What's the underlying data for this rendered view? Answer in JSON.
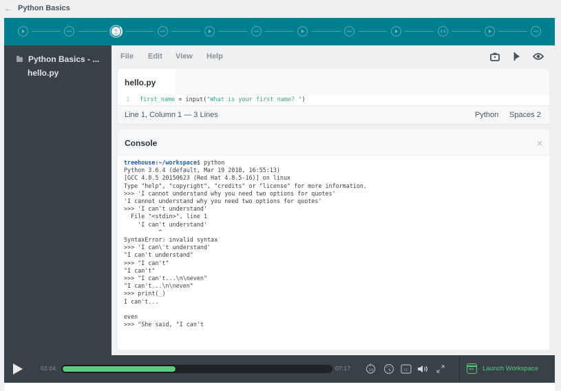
{
  "breadcrumb": {
    "back_icon": "arrow-left-icon",
    "title": "Python Basics"
  },
  "steps": [
    {
      "type": "video",
      "icon": "play-circle-icon",
      "current": false
    },
    {
      "type": "quiz",
      "icon": "ellipsis-circle-icon",
      "current": false
    },
    {
      "type": "current",
      "icon": "person-icon",
      "current": true
    },
    {
      "type": "quiz",
      "icon": "ellipsis-circle-icon",
      "current": false
    },
    {
      "type": "video",
      "icon": "play-circle-icon",
      "current": false
    },
    {
      "type": "quiz",
      "icon": "ellipsis-circle-icon",
      "current": false
    },
    {
      "type": "video",
      "icon": "play-circle-icon",
      "current": false
    },
    {
      "type": "quiz",
      "icon": "ellipsis-circle-icon",
      "current": false
    },
    {
      "type": "video",
      "icon": "play-circle-icon",
      "current": false
    },
    {
      "type": "code",
      "icon": "code-circle-icon",
      "current": false
    },
    {
      "type": "video",
      "icon": "play-circle-icon",
      "current": false
    },
    {
      "type": "quiz",
      "icon": "ellipsis-circle-icon",
      "current": false
    }
  ],
  "sidebar": {
    "folder": "Python Basics - ...",
    "files": [
      "hello.py"
    ]
  },
  "menubar": {
    "items": [
      "File",
      "Edit",
      "View",
      "Help"
    ],
    "icons": [
      "share-snapshot-icon",
      "fork-icon",
      "preview-eye-icon"
    ]
  },
  "editor": {
    "tab": "hello.py",
    "line_number": "1",
    "code": {
      "var": "first_name",
      "op": " = input(",
      "str": "\"What is your first name?  \"",
      "end": ")"
    },
    "status": {
      "position": "Line 1, Column 1 — 3 Lines",
      "language": "Python",
      "indent": "Spaces 2"
    }
  },
  "console": {
    "title": "Console",
    "close_icon": "close-icon",
    "prompt_user": "treehouse",
    "prompt_path": ":~/workspace",
    "prompt_symbol": "$ python",
    "lines": [
      "Python 3.6.4 (default, Mar 19 2018, 16:55:13)",
      "[GCC 4.8.5 20150623 (Red Hat 4.8.5-16)] on linux",
      "Type \"help\", \"copyright\", \"credits\" or \"license\" for more information.",
      ">>> 'I cannot understand why you need two options for quotes'",
      "'I cannot understand why you need two options for quotes'",
      ">>> 'I can't understand'",
      "  File \"<stdin>\", line 1",
      "    'I can't understand'",
      "          ^",
      "SyntaxError: invalid syntax",
      ">>> 'I can\\'t understand'",
      "\"I can't understand\"",
      ">>> \"I can't\"",
      "\"I can't\"",
      ">>> \"I can't...\\n\\neven\"",
      "\"I can't...\\n\\neven\"",
      ">>> print(_)",
      "I can't...",
      "",
      "even",
      ">>> \"She said, \"I can't"
    ]
  },
  "player": {
    "current_time": "03:04",
    "total_time": "07:17",
    "progress_fraction": 0.42,
    "controls": [
      "rewind-10-icon",
      "speed-icon",
      "closed-captions-icon",
      "volume-icon",
      "fullscreen-icon"
    ],
    "launch_label": "Launch Workspace",
    "colors": {
      "accent": "#5cc97c",
      "stepbar": "#00808f"
    }
  }
}
